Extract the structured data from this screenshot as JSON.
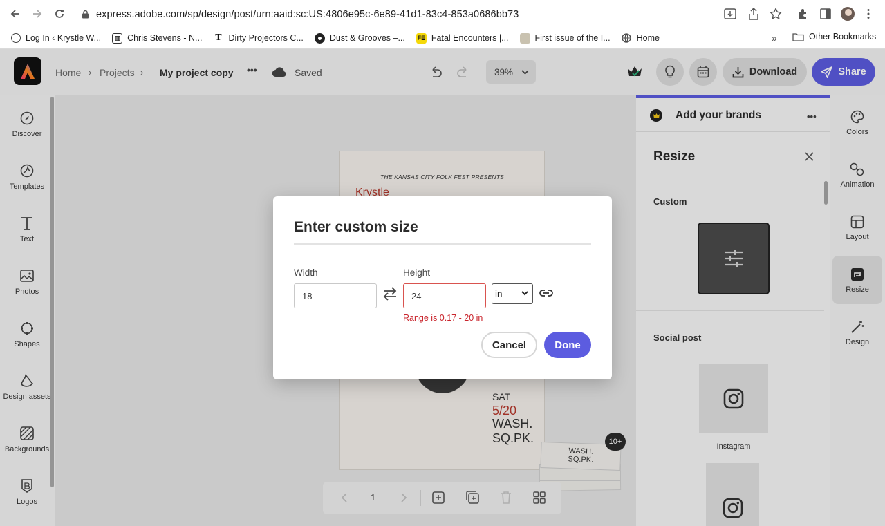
{
  "browser": {
    "url": "express.adobe.com/sp/design/post/urn:aaid:sc:US:4806e95c-6e89-41d1-83c4-853a0686bb73",
    "bookmarks": [
      {
        "label": "Log In ‹ Krystle W..."
      },
      {
        "label": "Chris Stevens - N..."
      },
      {
        "label": "Dirty Projectors C..."
      },
      {
        "label": "Dust & Grooves –..."
      },
      {
        "label": "Fatal Encounters |..."
      },
      {
        "label": "First issue of the I..."
      },
      {
        "label": "Home"
      }
    ],
    "bookmarks_overflow": "»",
    "other_bookmarks": "Other Bookmarks"
  },
  "header": {
    "breadcrumb_home": "Home",
    "breadcrumb_projects": "Projects",
    "project_name": "My project copy",
    "more_label": "•••",
    "save_status": "Saved",
    "zoom": "39%",
    "download_label": "Download",
    "share_label": "Share"
  },
  "left_rail": {
    "items": [
      {
        "label": "Discover"
      },
      {
        "label": "Templates"
      },
      {
        "label": "Text"
      },
      {
        "label": "Photos"
      },
      {
        "label": "Shapes"
      },
      {
        "label": "Design assets"
      },
      {
        "label": "Backgrounds"
      },
      {
        "label": "Logos"
      }
    ]
  },
  "poster": {
    "kicker": "THE KANSAS CITY FOLK FEST PRESENTS",
    "name_partial": "Krystle",
    "day": "SAT",
    "date": "5/20",
    "venue_line1": "WASH.",
    "venue_line2": "SQ.PK."
  },
  "pager": {
    "page": "1"
  },
  "thumbnail": {
    "badge": "10+",
    "line1": "WASH.",
    "line2": "SQ.PK."
  },
  "right_panel": {
    "brand_title": "Add your brands",
    "resize_title": "Resize",
    "custom_label": "Custom",
    "social_label": "Social post",
    "instagram_label": "Instagram"
  },
  "right_rail": {
    "items": [
      {
        "label": "Colors"
      },
      {
        "label": "Animation"
      },
      {
        "label": "Layout"
      },
      {
        "label": "Resize"
      },
      {
        "label": "Design"
      }
    ]
  },
  "dialog": {
    "title": "Enter custom size",
    "width_label": "Width",
    "width_value": "18",
    "height_label": "Height",
    "height_value": "24",
    "unit": "in",
    "error": "Range is 0.17 - 20 in",
    "cancel_label": "Cancel",
    "done_label": "Done"
  },
  "colors": {
    "accent": "#5c5ce0",
    "error": "#c9252d"
  }
}
